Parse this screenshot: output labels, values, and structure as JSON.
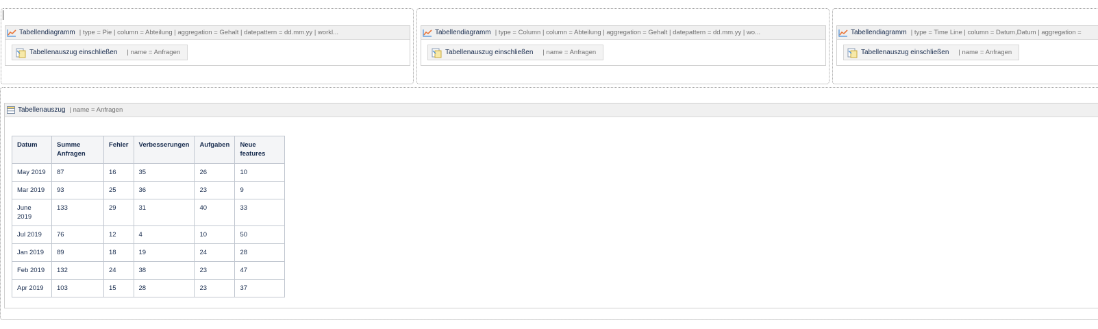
{
  "charts": [
    {
      "title": "Tabellendiagramm",
      "params": "| type = Pie | column = Abteilung | aggregation = Gehalt | datepattern = dd.mm.yy | workl...",
      "include": {
        "title": "Tabellenauszug einschließen",
        "params": "| name = Anfragen"
      }
    },
    {
      "title": "Tabellendiagramm",
      "params": "| type = Column | column = Abteilung | aggregation = Gehalt | datepattern = dd.mm.yy | wo...",
      "include": {
        "title": "Tabellenauszug einschließen",
        "params": "| name = Anfragen"
      }
    },
    {
      "title": "Tabellendiagramm",
      "params": "| type = Time Line | column = Datum,Datum | aggregation =",
      "include": {
        "title": "Tabellenauszug einschließen",
        "params": "| name = Anfragen"
      }
    }
  ],
  "excerpt": {
    "title": "Tabellenauszug",
    "params": "| name = Anfragen",
    "columns": [
      "Datum",
      "Summe Anfragen",
      "Fehler",
      "Verbesserungen",
      "Aufgaben",
      "Neue features"
    ],
    "rows": [
      [
        "May 2019",
        "87",
        "16",
        "35",
        "26",
        "10"
      ],
      [
        "Mar 2019",
        "93",
        "25",
        "36",
        "23",
        "9"
      ],
      [
        "June 2019",
        "133",
        "29",
        "31",
        "40",
        "33"
      ],
      [
        "Jul 2019",
        "76",
        "12",
        "4",
        "10",
        "50"
      ],
      [
        "Jan 2019",
        "89",
        "18",
        "19",
        "24",
        "28"
      ],
      [
        "Feb 2019",
        "132",
        "24",
        "38",
        "23",
        "47"
      ],
      [
        "Apr 2019",
        "103",
        "15",
        "28",
        "23",
        "37"
      ]
    ]
  },
  "icons": {
    "chart": "line-chart-icon",
    "include": "include-excerpt-icon",
    "table": "table-icon"
  },
  "colors": {
    "chart_line": "#e8773c",
    "chart_axis": "#4a90d9",
    "macro_header_bg": "#f0f0f0",
    "table_header_bg": "#f4f5f7",
    "table_border": "#c1c7d0"
  }
}
